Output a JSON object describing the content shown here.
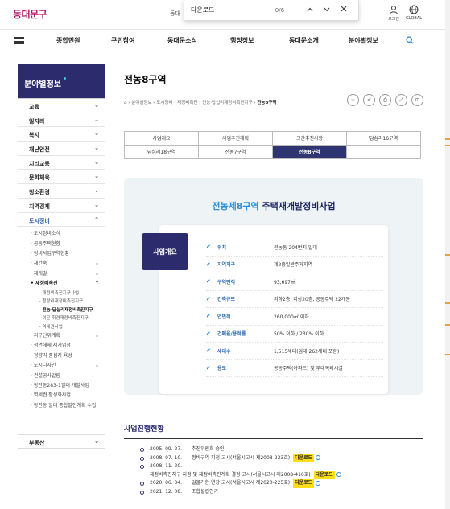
{
  "header": {
    "logo": "동대문구",
    "site_label": "동대",
    "find": {
      "query": "다운로드",
      "count": "0/6",
      "up": "⌃",
      "down": "⌄",
      "close": "✕"
    },
    "utils": [
      {
        "label": "로그인",
        "icon": "person-icon"
      },
      {
        "label": "GLOBAL",
        "icon": "globe-icon"
      }
    ]
  },
  "gnb": {
    "items": [
      "종합민원",
      "구민참여",
      "동대문소식",
      "행정정보",
      "동대문소개",
      "분야별정보"
    ]
  },
  "sidebar": {
    "title": "분야별정보",
    "items": [
      {
        "label": "교육",
        "chev": "⌄"
      },
      {
        "label": "일자리",
        "chev": "⌄"
      },
      {
        "label": "복지",
        "chev": "⌄"
      },
      {
        "label": "재난안전",
        "chev": "⌄"
      },
      {
        "label": "지리교통",
        "chev": "⌄"
      },
      {
        "label": "문화체육",
        "chev": "⌄"
      },
      {
        "label": "청소환경",
        "chev": "⌄"
      },
      {
        "label": "지역경제",
        "chev": "⌄"
      },
      {
        "label": "도시정비",
        "chev": "⌃"
      }
    ],
    "sub": [
      {
        "label": "도시정비소식",
        "chev": ""
      },
      {
        "label": "공동주택현황",
        "chev": ""
      },
      {
        "label": "정비사업구역현황",
        "chev": ""
      },
      {
        "label": "재건축",
        "chev": "⌄"
      },
      {
        "label": "재개발",
        "chev": "⌄"
      },
      {
        "label": "재정비촉진",
        "chev": "⌃"
      }
    ],
    "sub2": [
      "재정비촉진지구사업",
      "청량리재정비촉진지구",
      "전농·답십리재정비촉진지구",
      "이문·휘경재정비촉진지구",
      "역세권사업"
    ],
    "sub_after": [
      {
        "label": "지구단위계획",
        "chev": "⌄"
      },
      {
        "label": "석면해체·제거엄정",
        "chev": ""
      },
      {
        "label": "청량리 중심지 육성",
        "chev": ""
      },
      {
        "label": "도시디자인",
        "chev": "⌄"
      },
      {
        "label": "건설공사알림",
        "chev": ""
      },
      {
        "label": "장안동283-1일대 개발사업",
        "chev": ""
      },
      {
        "label": "역세권 활성화사업",
        "chev": ""
      },
      {
        "label": "장안동 일대 종합발전계획 수립",
        "chev": ""
      }
    ],
    "last": {
      "label": "부동산",
      "chev": "⌄"
    }
  },
  "page": {
    "title": "전농8구역",
    "breadcrumb": [
      "분야별정보",
      "도시정비",
      "재정비촉진",
      "전농·답십리재정비촉진지구",
      "전농8구역"
    ],
    "tools": [
      "☆",
      "⋖",
      "⎙",
      "⤢",
      "⊡"
    ]
  },
  "tabs": [
    [
      "사업개요",
      "사업추진계획",
      "그간추진사항",
      "답십리16구역"
    ],
    [
      "답십리18구역",
      "전농7구역",
      "전농8구역",
      ""
    ]
  ],
  "hero": {
    "title_hl": "전농제8구역",
    "title_rest": " 주택재개발정비사업",
    "badge": "사업개요",
    "specs": [
      {
        "k": "위치",
        "v": "전농동 204번지 일대"
      },
      {
        "k": "지역지구",
        "v": "제2종일반주거지역"
      },
      {
        "k": "구역면적",
        "v": "93,697㎡"
      },
      {
        "k": "건축규모",
        "v": "지하2층, 지상20층, 공동주택 22개동"
      },
      {
        "k": "연면적",
        "v": "260,000㎡ 이하"
      },
      {
        "k": "건폐율/용적률",
        "v": "50% 이하 / 230% 이하"
      },
      {
        "k": "세대수",
        "v": "1,515세대(임대 262세대 포함)"
      },
      {
        "k": "용도",
        "v": "공동주택(아파트) 및 부대복리시설"
      }
    ]
  },
  "progress": {
    "title": "사업진행현황",
    "download_label": "다운로드",
    "rows": [
      {
        "date": "2005. 09. 27.",
        "text": "추진위원회 승인",
        "dl": false
      },
      {
        "date": "2008. 07. 10.",
        "text": "정비구역 지정 고시(서울시고시 제2008-233호)",
        "dl": true
      },
      {
        "date": "2008. 11. 20.",
        "text": "",
        "dl": false
      },
      {
        "date": "",
        "text": "재정비촉진지구 지정 및 재정비촉진계획 결정 고시(서울시고시 제2008-416호)",
        "dl": true
      },
      {
        "date": "2020. 06. 04.",
        "text": "일몰기한 연장 고시(서울시고시 제2020-225호)",
        "dl": true
      },
      {
        "date": "2021. 12. 08.",
        "text": "조합설립인가",
        "dl": false
      }
    ]
  }
}
